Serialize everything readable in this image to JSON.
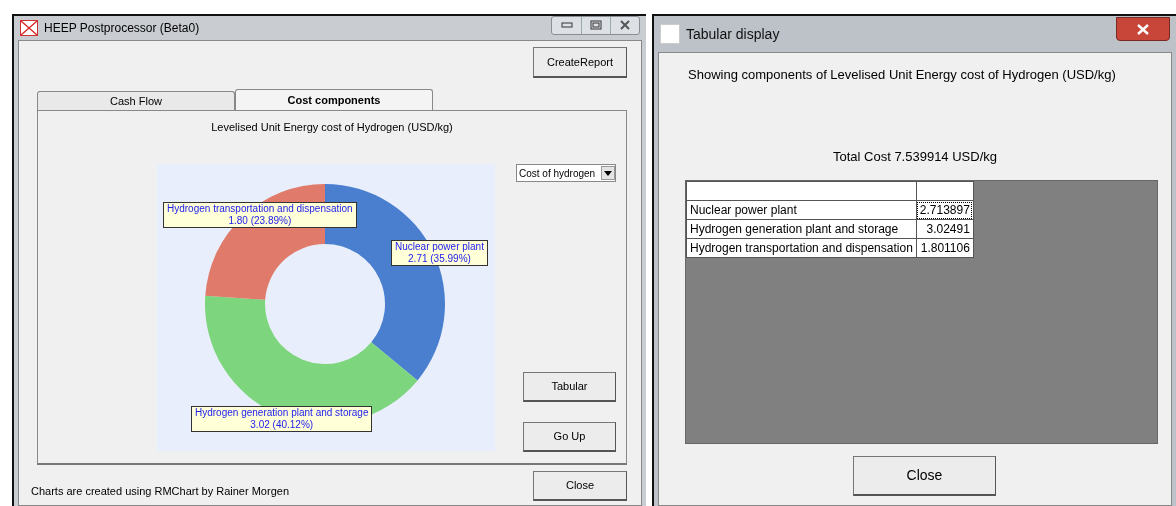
{
  "main_window": {
    "title": "HEEP Postprocessor (Beta0)",
    "create_report_button": "CreateReport",
    "tabs": [
      {
        "label": "Cash Flow",
        "selected": false
      },
      {
        "label": "Cost components",
        "selected": true
      }
    ],
    "chart_heading": "Levelised Unit Energy cost of Hydrogen (USD/kg)",
    "dropdown": {
      "value": "Cost of hydrogen"
    },
    "chart_data": {
      "type": "donut",
      "categories": [
        "Nuclear power plant",
        "Hydrogen generation plant and storage",
        "Hydrogen transportation and dispensation"
      ],
      "series": [
        {
          "values": [
            35.99,
            40.12,
            23.89
          ]
        }
      ],
      "colors": [
        "#4a7fd0",
        "#7dd67d",
        "#e07a6a"
      ],
      "value_labels": [
        "2.71 (35.99%)",
        "3.02 (40.12%)",
        "1.80 (23.89%)"
      ]
    },
    "tabular_button": "Tabular",
    "go_up_button": "Go Up",
    "footer": "Charts are created using RMChart by Rainer Morgen",
    "close_button": "Close"
  },
  "tabular_window": {
    "title": "Tabular display",
    "heading": "Showing components of Levelised Unit Energy cost of Hydrogen (USD/kg)",
    "total": "Total Cost 7.539914 USD/kg",
    "rows": [
      {
        "label": "Nuclear power plant",
        "value": "2.713897",
        "selected": true
      },
      {
        "label": "Hydrogen generation plant and storage",
        "value": "3.02491",
        "selected": false
      },
      {
        "label": "Hydrogen transportation and dispensation",
        "value": "1.801106",
        "selected": false
      }
    ],
    "close_button": "Close"
  }
}
